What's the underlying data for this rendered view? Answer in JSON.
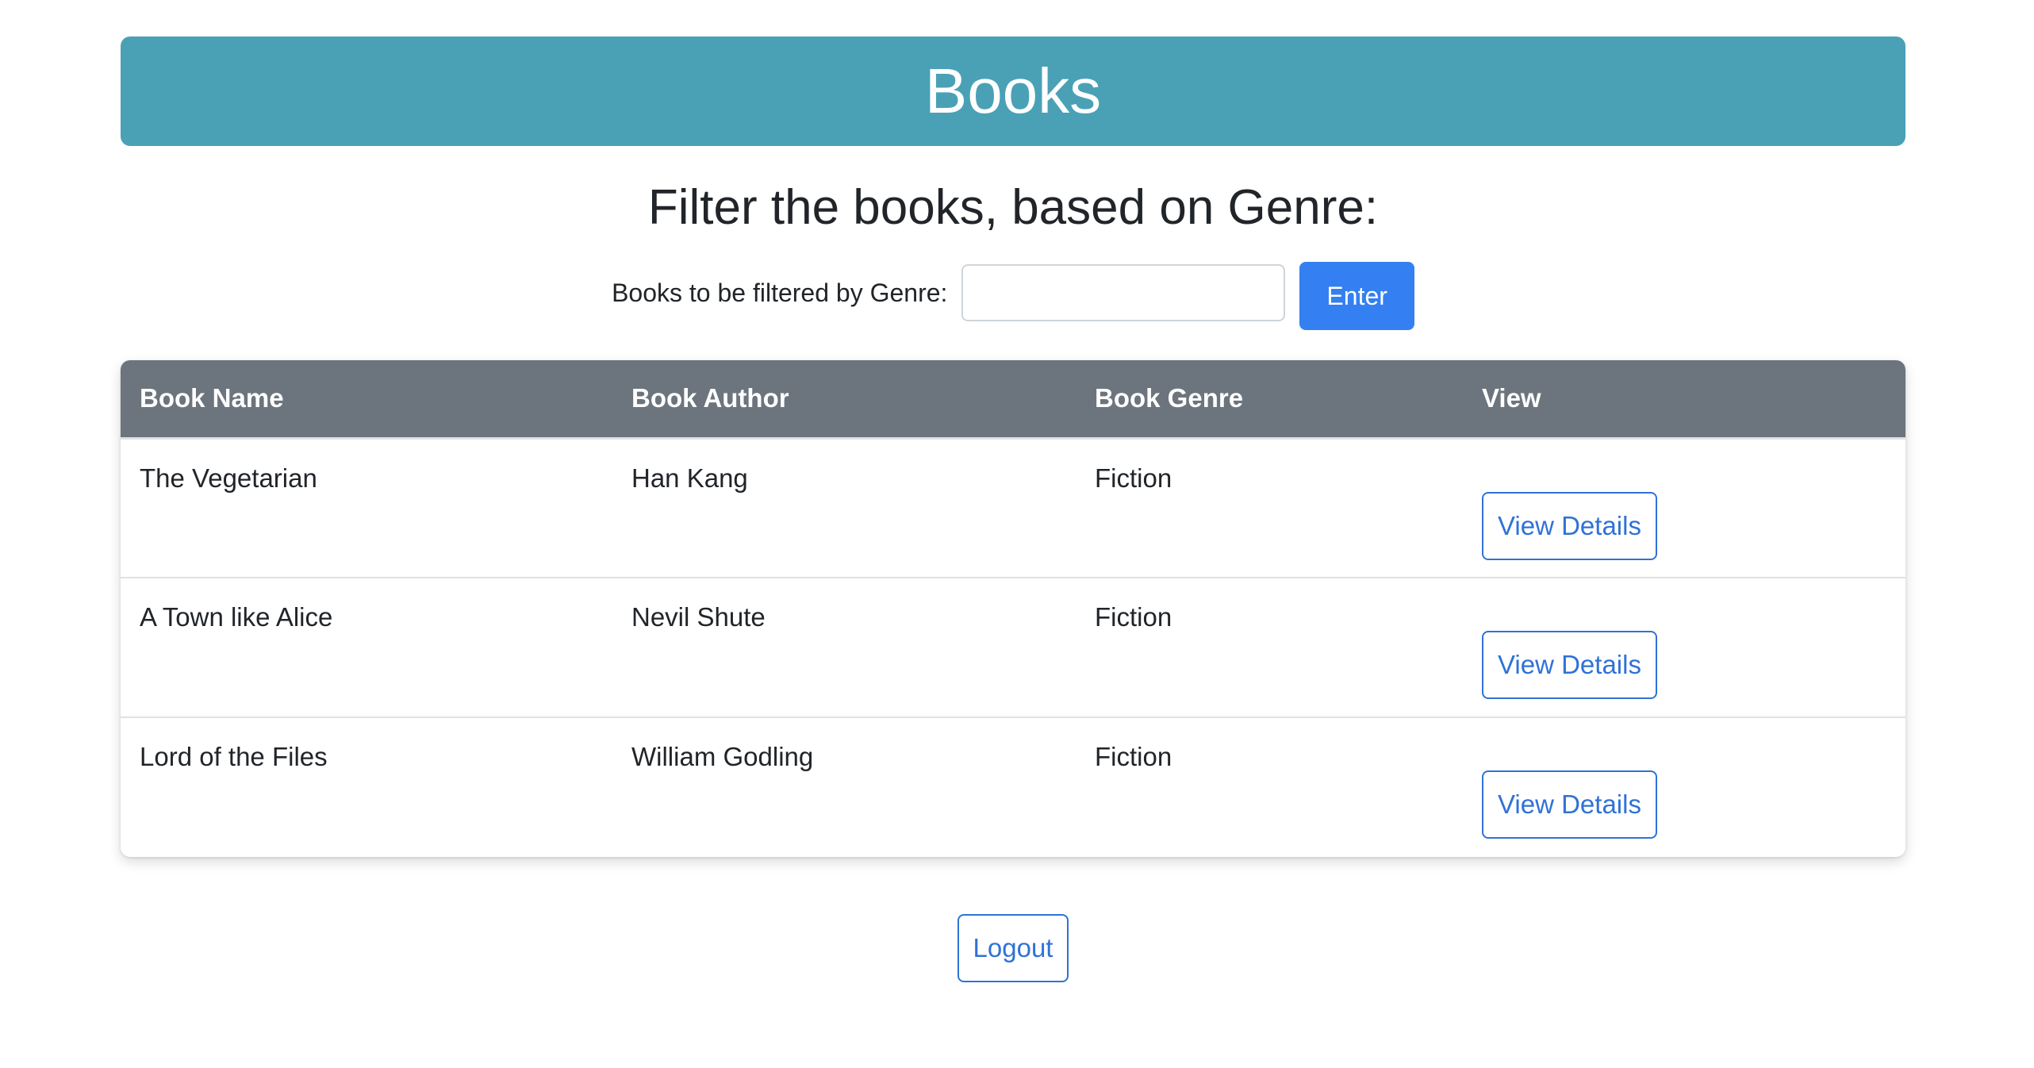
{
  "header": {
    "title": "Books"
  },
  "filter": {
    "heading": "Filter the books, based on Genre:",
    "label": "Books to be filtered by Genre:",
    "input_value": "",
    "input_placeholder": "",
    "submit_label": "Enter"
  },
  "table": {
    "columns": [
      "Book Name",
      "Book Author",
      "Book Genre",
      "View"
    ],
    "rows": [
      {
        "name": "The Vegetarian",
        "author": "Han Kang",
        "genre": "Fiction",
        "action": "View Details"
      },
      {
        "name": "A Town like Alice",
        "author": "Nevil Shute",
        "genre": "Fiction",
        "action": "View Details"
      },
      {
        "name": "Lord of the Files",
        "author": "William Godling",
        "genre": "Fiction",
        "action": "View Details"
      }
    ]
  },
  "footer": {
    "logout_label": "Logout"
  },
  "colors": {
    "banner": "#4aa1b6",
    "table_header": "#6c757d",
    "primary": "#3480f2",
    "outline": "#2f72d6"
  }
}
